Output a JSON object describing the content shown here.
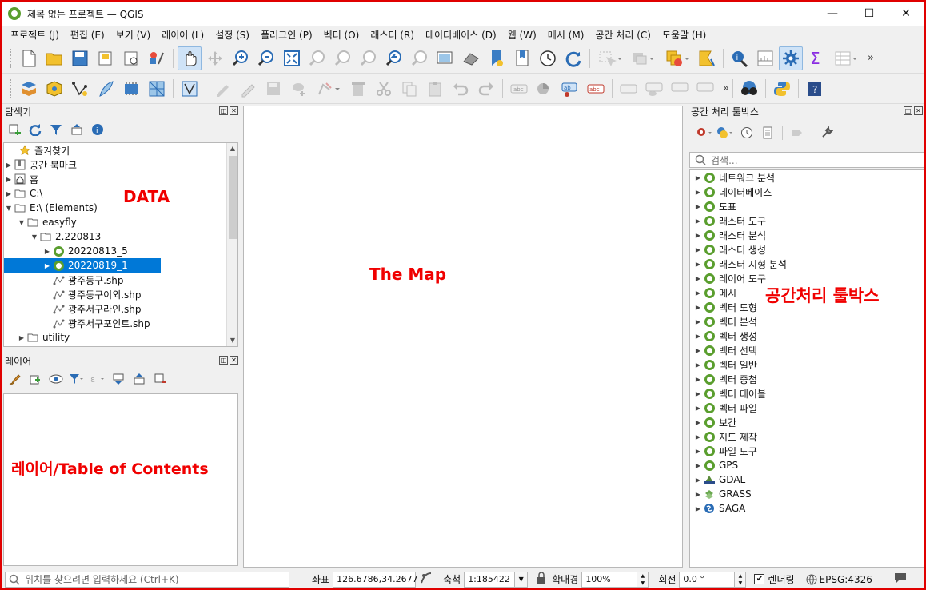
{
  "window": {
    "title": "제목 없는 프로젝트 — QGIS",
    "minimize": "—",
    "maximize": "☐",
    "close": "✕"
  },
  "menu": [
    "프로젝트 (J)",
    "편집 (E)",
    "보기 (V)",
    "레이어 (L)",
    "설정 (S)",
    "플러그인 (P)",
    "벡터 (O)",
    "래스터 (R)",
    "데이터베이스 (D)",
    "웹 (W)",
    "메시 (M)",
    "공간 처리 (C)",
    "도움말 (H)"
  ],
  "browser": {
    "title": "탐색기",
    "items": [
      {
        "label": "즐겨찾기",
        "icon": "star-icon"
      },
      {
        "label": "공간 북마크",
        "icon": "bookmark-icon"
      },
      {
        "label": "홈",
        "icon": "home-icon"
      },
      {
        "label": "C:\\",
        "icon": "drive-icon"
      },
      {
        "label": "E:\\ (Elements)",
        "icon": "drive-icon"
      },
      {
        "label": "easyfly",
        "icon": "folder-icon"
      },
      {
        "label": "2.220813",
        "icon": "folder-icon"
      },
      {
        "label": "20220813_5",
        "icon": "qgis-project-icon"
      },
      {
        "label": "20220819_1",
        "icon": "qgis-project-icon"
      },
      {
        "label": "광주동구.shp",
        "icon": "shapefile-icon"
      },
      {
        "label": "광주동구이외.shp",
        "icon": "shapefile-icon"
      },
      {
        "label": "광주서구라인.shp",
        "icon": "shapefile-icon"
      },
      {
        "label": "광주서구포인트.shp",
        "icon": "shapefile-icon"
      },
      {
        "label": "utility",
        "icon": "folder-icon"
      }
    ]
  },
  "layers": {
    "title": "레이어"
  },
  "processing": {
    "title": "공간 처리 툴박스",
    "search_placeholder": "검색...",
    "items": [
      "네트워크 분석",
      "데이터베이스",
      "도표",
      "래스터 도구",
      "래스터 분석",
      "래스터 생성",
      "래스터 지형 분석",
      "레이어 도구",
      "메시",
      "벡터 도형",
      "벡터 분석",
      "벡터 생성",
      "벡터 선택",
      "벡터 일반",
      "벡터 중첩",
      "벡터 테이블",
      "벡터 파일",
      "보간",
      "지도 제작",
      "파일 도구",
      "GPS",
      "GDAL",
      "GRASS",
      "SAGA"
    ]
  },
  "annotations": {
    "data": "DATA",
    "map": "The Map",
    "toolbox": "공간처리 툴박스",
    "toc": "레이어/Table of Contents"
  },
  "status": {
    "locator_placeholder": "위치를 찾으려면 입력하세요 (Ctrl+K)",
    "coord_label": "좌표",
    "coord_value": "126.6786,34.2677",
    "scale_label": "축척",
    "scale_value": "1:185422",
    "magnifier_label": "확대경",
    "magnifier_value": "100%",
    "rotation_label": "회전",
    "rotation_value": "0.0 °",
    "render_label": "렌더링",
    "crs": "EPSG:4326"
  },
  "colors": {
    "qgis_green": "#5a9e2e",
    "selection": "#0078d7",
    "annotation_red": "#f00000"
  }
}
